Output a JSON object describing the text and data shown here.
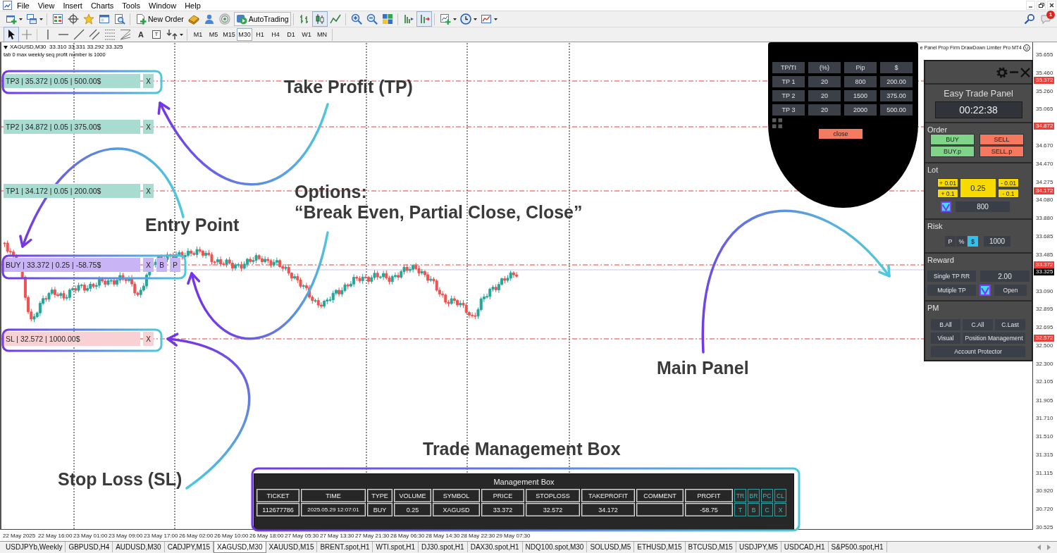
{
  "menu": [
    "File",
    "View",
    "Insert",
    "Charts",
    "Tools",
    "Window",
    "Help"
  ],
  "toolbar": {
    "new_order": "New Order",
    "auto_trading": {
      "label": "AutoTrading",
      "on": true
    },
    "chart_types": [
      {
        "selected": false
      },
      {
        "selected": true
      },
      {
        "selected": false
      }
    ],
    "auto_scroll": true,
    "notifications": "1"
  },
  "drawing_toolbar": {
    "cursor_selected": true,
    "text_tool": "A",
    "label_tool": "T"
  },
  "timeframes": [
    {
      "label": "M1",
      "selected": false
    },
    {
      "label": "M5",
      "selected": false
    },
    {
      "label": "M15",
      "selected": false
    },
    {
      "label": "M30",
      "selected": true
    },
    {
      "label": "H1",
      "selected": false
    },
    {
      "label": "H4",
      "selected": false
    },
    {
      "label": "D1",
      "selected": false
    },
    {
      "label": "W1",
      "selected": false
    },
    {
      "label": "MN",
      "selected": false
    }
  ],
  "chart": {
    "symbol_info": "XAGUSD,M30  33.310 33.331 33.292 33.325",
    "comment": "tab 0 max weekly seq profit number is 1000",
    "expert_name": "e Panel Prop Firm DrawDown Limiter Pro MT4",
    "trade_lines": [
      {
        "kind": "tp",
        "label": "TP3 | 35.372 | 0.05 | 500.00$",
        "buttons": [
          "X"
        ]
      },
      {
        "kind": "tp",
        "label": "TP2 | 34.872 | 0.05 | 375.00$",
        "buttons": [
          "X"
        ]
      },
      {
        "kind": "tp",
        "label": "TP1 | 34.172 | 0.05 | 200.00$",
        "buttons": [
          "X"
        ]
      },
      {
        "kind": "entry",
        "label": "BUY | 33.372 | 0.25 | -58.75$",
        "buttons": [
          "X",
          "B",
          "P"
        ]
      },
      {
        "kind": "sl",
        "label": "SL | 32.572 | 1000.00$",
        "buttons": [
          "X"
        ]
      }
    ],
    "annotations": [
      "Take Profit (TP)",
      "Options:",
      "“Break Even, Partial Close, Close”",
      "Entry Point",
      "Main Panel",
      "Trade Management Box",
      "Stop Loss (SL)"
    ],
    "price_axis": [
      {
        "text": "35.655",
        "kind": "tick"
      },
      {
        "text": "35.460",
        "kind": "tick"
      },
      {
        "text": "35.372",
        "kind": "level"
      },
      {
        "text": "35.260",
        "kind": "tick"
      },
      {
        "text": "35.065",
        "kind": "tick"
      },
      {
        "text": "34.872",
        "kind": "level"
      },
      {
        "text": "34.670",
        "kind": "tick"
      },
      {
        "text": "34.470",
        "kind": "tick"
      },
      {
        "text": "34.275",
        "kind": "tick"
      },
      {
        "text": "34.172",
        "kind": "level"
      },
      {
        "text": "34.080",
        "kind": "tick"
      },
      {
        "text": "33.880",
        "kind": "tick"
      },
      {
        "text": "33.685",
        "kind": "tick"
      },
      {
        "text": "33.485",
        "kind": "tick"
      },
      {
        "text": "33.372",
        "kind": "level"
      },
      {
        "text": "33.325",
        "kind": "bid"
      },
      {
        "text": "33.090",
        "kind": "tick"
      },
      {
        "text": "32.895",
        "kind": "tick"
      },
      {
        "text": "32.695",
        "kind": "tick"
      },
      {
        "text": "32.572",
        "kind": "level"
      },
      {
        "text": "32.500",
        "kind": "tick"
      },
      {
        "text": "32.300",
        "kind": "tick"
      },
      {
        "text": "32.105",
        "kind": "tick"
      },
      {
        "text": "31.905",
        "kind": "tick"
      },
      {
        "text": "31.710",
        "kind": "tick"
      },
      {
        "text": "31.510",
        "kind": "tick"
      },
      {
        "text": "31.315",
        "kind": "tick"
      },
      {
        "text": "31.115",
        "kind": "tick"
      },
      {
        "text": "30.920",
        "kind": "tick"
      },
      {
        "text": "30.720",
        "kind": "tick"
      },
      {
        "text": "30.525",
        "kind": "tick"
      }
    ],
    "time_axis": [
      "22 May 2025",
      "22 May 16:00",
      "23 May 01:00",
      "23 May 09:00",
      "23 May 17:00",
      "26 May 02:00",
      "26 May 10:00",
      "26 May 18:00",
      "27 May 05:30",
      "27 May 13:30",
      "27 May 21:30",
      "28 May 06:30",
      "28 May 14:30",
      "28 May 22:30",
      "29 May 07:30"
    ]
  },
  "tp_table": {
    "columns": [
      "TP/TI",
      "(%)",
      "Pip",
      "$"
    ],
    "rows": [
      [
        "TP 1",
        "20",
        "800",
        "200.00"
      ],
      [
        "TP 2",
        "20",
        "1500",
        "375.00"
      ],
      [
        "TP 3",
        "20",
        "2000",
        "500.00"
      ]
    ],
    "close": "close"
  },
  "main_panel": {
    "title": "Easy Trade Panel",
    "timer": "00:22:38",
    "order": {
      "label": "Order",
      "buttons": [
        {
          "label": "BUY",
          "kind": "buy"
        },
        {
          "label": "SELL",
          "kind": "sell"
        },
        {
          "label": "BUY.p",
          "kind": "buy"
        },
        {
          "label": "SELL.p",
          "kind": "sell"
        }
      ]
    },
    "lot": {
      "label": "Lot",
      "increase": [
        "+ 0.01",
        "+ 0.1"
      ],
      "value": "0.25",
      "decrease": [
        "- 0.01",
        "- 0.1"
      ],
      "checked": true,
      "points": "800"
    },
    "risk": {
      "label": "Risk",
      "modes": [
        {
          "label": "P",
          "selected": false
        },
        {
          "label": "%",
          "selected": false
        },
        {
          "label": "$",
          "selected": true
        }
      ],
      "amount": "1000"
    },
    "reward": {
      "label": "Reward",
      "single_tp": "Single TP RR",
      "ratio": "2.00",
      "multiple_tp": "Mutiple TP",
      "multiple_checked": true,
      "open": "Open"
    },
    "pm": {
      "label": "PM",
      "buttons": [
        "B.All",
        "C.All",
        "C.Last",
        "Visual",
        "Position Management",
        "Account Protector"
      ]
    }
  },
  "management_box": {
    "title": "Management Box",
    "columns": [
      "TICKET",
      "TIME",
      "TYPE",
      "VOLUME",
      "SYMBOL",
      "PRICE",
      "STOPLOSS",
      "TAKEPROFIT",
      "COMMENT",
      "PROFIT"
    ],
    "column_actions": [
      "TR",
      "BR",
      "PC",
      "CL"
    ],
    "rows": [
      {
        "ticket": "112677786",
        "time": "2025.05.29 12:07:01",
        "type": "BUY",
        "volume": "0.25",
        "symbol": "XAGUSD",
        "price": "33.372",
        "stoploss": "32.572",
        "takeprofit": "34.172",
        "profit": "-58.75",
        "actions": [
          "T",
          "B",
          "C",
          "X"
        ]
      }
    ]
  },
  "symbol_tabs": [
    {
      "label": "USDJPYb,Weekly",
      "selected": false
    },
    {
      "label": "GBPUSD,H4",
      "selected": false
    },
    {
      "label": "AUDUSD,M30",
      "selected": false
    },
    {
      "label": "CADJPY,M15",
      "selected": false
    },
    {
      "label": "XAGUSD,M30",
      "selected": true
    },
    {
      "label": "XAUUSD,M15",
      "selected": false
    },
    {
      "label": "BRENT.spot,H1",
      "selected": false
    },
    {
      "label": "WTI.spot,H1",
      "selected": false
    },
    {
      "label": "DJ30.spot,H1",
      "selected": false
    },
    {
      "label": "DAX30.spot,H1",
      "selected": false
    },
    {
      "label": "NDQ100.spot,M30",
      "selected": false
    },
    {
      "label": "SOLUSD,M5",
      "selected": false
    },
    {
      "label": "ETHUSD,M15",
      "selected": false
    },
    {
      "label": "BTCUSD,M15",
      "selected": false
    },
    {
      "label": "USDJPY,M5",
      "selected": false
    },
    {
      "label": "USDCAD,H1",
      "selected": false
    },
    {
      "label": "S&P500.spot,H1",
      "selected": false
    }
  ]
}
